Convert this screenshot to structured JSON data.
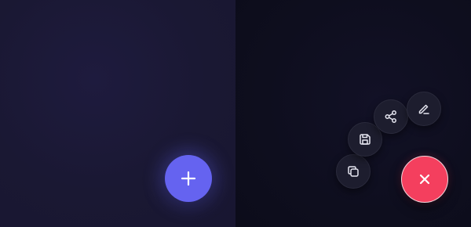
{
  "left_panel": {
    "state": "closed",
    "fab": {
      "icon": "plus-icon",
      "color": "#6563f0"
    }
  },
  "right_panel": {
    "state": "open",
    "fab": {
      "icon": "close-icon",
      "color": "#f43f5e"
    },
    "actions": [
      {
        "id": "copy",
        "icon": "copy-icon"
      },
      {
        "id": "save",
        "icon": "save-icon"
      },
      {
        "id": "share",
        "icon": "share-icon"
      },
      {
        "id": "edit",
        "icon": "edit-icon"
      }
    ]
  },
  "colors": {
    "action_bg": "#1d1d2e",
    "action_icon": "#e6e6f0",
    "fab_icon": "#ffffff"
  }
}
